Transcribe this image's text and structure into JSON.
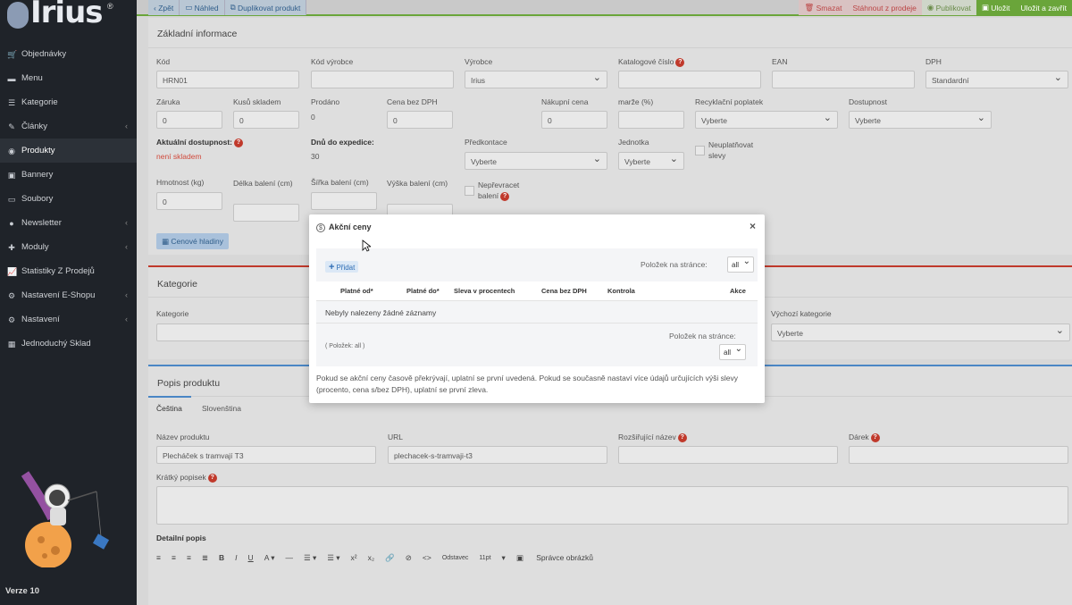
{
  "sidebar": {
    "logo": "Irius",
    "items": [
      {
        "label": "Objednávky",
        "icon": "cart-icon",
        "glyph": "🛒",
        "chev": false
      },
      {
        "label": "Menu",
        "icon": "folder-icon",
        "glyph": "▬",
        "chev": false
      },
      {
        "label": "Kategorie",
        "icon": "list-icon",
        "glyph": "☰",
        "chev": false
      },
      {
        "label": "Články",
        "icon": "pencil-icon",
        "glyph": "✎",
        "chev": true
      },
      {
        "label": "Produkty",
        "icon": "palette-icon",
        "glyph": "◉",
        "chev": false,
        "active": true
      },
      {
        "label": "Bannery",
        "icon": "image-icon",
        "glyph": "▣",
        "chev": false
      },
      {
        "label": "Soubory",
        "icon": "file-icon",
        "glyph": "▭",
        "chev": false
      },
      {
        "label": "Newsletter",
        "icon": "globe-icon",
        "glyph": "●",
        "chev": true
      },
      {
        "label": "Moduly",
        "icon": "puzzle-icon",
        "glyph": "✚",
        "chev": true
      },
      {
        "label": "Statistiky Z Prodejů",
        "icon": "chart-icon",
        "glyph": "📈",
        "chev": false
      },
      {
        "label": "Nastavení E-Shopu",
        "icon": "gear-icon",
        "glyph": "⚙",
        "chev": true
      },
      {
        "label": "Nastavení",
        "icon": "gear-icon",
        "glyph": "⚙",
        "chev": true
      },
      {
        "label": "Jednoduchý Sklad",
        "icon": "boxes-icon",
        "glyph": "▦",
        "chev": false
      }
    ],
    "version": "Verze 10"
  },
  "topbar": {
    "back": "Zpět",
    "preview": "Náhled",
    "duplicate": "Duplikovat produkt",
    "delete": "Smazat",
    "withdraw": "Stáhnout z prodeje",
    "publish": "Publikovat",
    "save": "Uložit",
    "save_close": "Uložit a zavřít"
  },
  "basic": {
    "title": "Základní informace",
    "kod_label": "Kód",
    "kod": "HRN01",
    "kod_vyrobce_label": "Kód výrobce",
    "vyrobce_label": "Výrobce",
    "vyrobce": "Irius",
    "katalog_label": "Katalogové číslo",
    "ean_label": "EAN",
    "dph_label": "DPH",
    "dph": "Standardní",
    "zaruka_label": "Záruka",
    "zaruka": "0",
    "kusu_label": "Kusů skladem",
    "kusu": "0",
    "prodano_label": "Prodáno",
    "prodano": "0",
    "cena_bez_label": "Cena bez DPH",
    "cena_bez": "0",
    "nakupni_label": "Nákupní cena",
    "nakupni": "0",
    "marze_label": "marže (%)",
    "recykl_label": "Recyklační poplatek",
    "recykl": "Vyberte",
    "dostupnost_label": "Dostupnost",
    "dostupnost": "Vyberte",
    "akt_dost_label": "Aktuální dostupnost:",
    "akt_dost": "není skladem",
    "dnu_label": "Dnů do expedice:",
    "dnu": "30",
    "predkontace_label": "Předkontace",
    "predkontace": "Vyberte",
    "jednotka_label": "Jednotka",
    "jednotka": "Vyberte",
    "neuplatnovat_label": "Neuplatňovat slevy",
    "hmotnost_label": "Hmotnost (kg)",
    "hmotnost": "0",
    "delka_label": "Délka balení (cm)",
    "sirka_label": "Šířka balení (cm)",
    "vyska_label": "Výška balení (cm)",
    "neprevracet_label": "Nepřevracet balení",
    "cenove_btn": "Cenové hladiny"
  },
  "category": {
    "title": "Kategorie",
    "label": "Kategorie",
    "default_label": "Výchozí kategorie",
    "default_value": "Vyberte"
  },
  "description": {
    "title": "Popis produktu",
    "tabs": [
      "Čeština",
      "Slovenština"
    ],
    "name_label": "Název produktu",
    "name": "Plecháček s tramvají T3",
    "url_label": "URL",
    "url": "plechacek-s-tramvaji-t3",
    "ext_label": "Rozšiřující název",
    "gift_label": "Dárek",
    "short_label": "Krátký popisek",
    "detail_label": "Detailní popis",
    "toolbar": {
      "style": "Odstavec",
      "size": "11pt",
      "images": "Správce obrázků"
    }
  },
  "modal": {
    "title": "Akční ceny",
    "add": "Přidat",
    "per_page_label": "Položek na stránce:",
    "per_page": "all",
    "columns": [
      "Platné od*",
      "Platné do*",
      "Sleva v procentech",
      "Cena bez DPH",
      "Kontrola",
      "Akce"
    ],
    "empty": "Nebyly nalezeny žádné záznamy",
    "count": "( Položek: all )",
    "note": "Pokud se akční ceny časově překrývají, uplatní se první uvedená. Pokud se současně nastaví více údajů určujících výši slevy (procento, cena s/bez DPH), uplatní se první zleva."
  }
}
